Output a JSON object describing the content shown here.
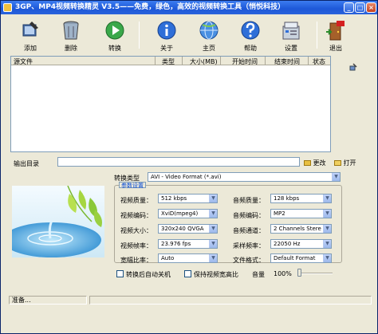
{
  "window": {
    "title": "3GP、MP4视频转换精灵 V3.5——免费，绿色，高效的视频转换工具（悄悦科技）"
  },
  "toolbar": {
    "add": "添加",
    "delete": "删除",
    "convert": "转换",
    "about": "关于",
    "home": "主页",
    "help": "帮助",
    "settings": "设置",
    "exit": "退出"
  },
  "file_list": {
    "columns": [
      "源文件",
      "类型",
      "大小(MB)",
      "开始时间",
      "结束时间",
      "状态"
    ]
  },
  "output": {
    "label": "输出目录",
    "value": "",
    "change": "更改",
    "open": "打开"
  },
  "convert_type": {
    "label": "转换类型",
    "value": "AVI - Video Format (*.avi)"
  },
  "params": {
    "group_title": "参数设置",
    "video_quality": {
      "label": "视频质量：",
      "value": "512 kbps"
    },
    "video_codec": {
      "label": "视频编码：",
      "value": "XviD(mpeg4)"
    },
    "video_size": {
      "label": "视频大小：",
      "value": "320x240 QVGA"
    },
    "video_fps": {
      "label": "视频帧率：",
      "value": "23.976 fps"
    },
    "aspect": {
      "label": "宽幅比率：",
      "value": "Auto"
    },
    "audio_quality": {
      "label": "音频质量：",
      "value": "128 kbps"
    },
    "audio_codec": {
      "label": "音频编码：",
      "value": "MP2"
    },
    "audio_channels": {
      "label": "音频通道：",
      "value": "2 Channels Stere"
    },
    "sample_rate": {
      "label": "采样频率：",
      "value": "22050 Hz"
    },
    "file_format": {
      "label": "文件格式：",
      "value": "Default Format"
    }
  },
  "options": {
    "shutdown": "转换后自动关机",
    "keep_aspect": "保持视频宽高比",
    "volume_label": "音量",
    "volume_value": "100%",
    "volume_level": 0.0
  },
  "status": {
    "text": "准备..."
  },
  "colors": {
    "title_bar": "#1d58d8",
    "accent": "#0046d5",
    "face": "#ece9d8"
  }
}
